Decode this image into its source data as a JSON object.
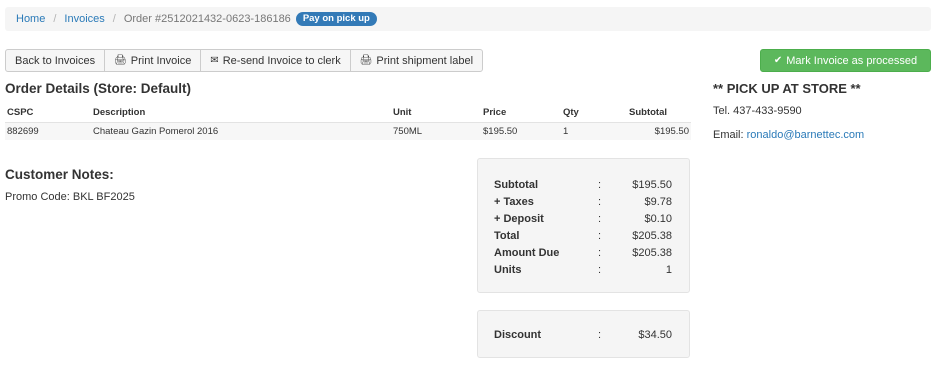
{
  "breadcrumb": {
    "home": "Home",
    "invoices": "Invoices",
    "current": "Order #2512021432-0623-186186",
    "badge": "Pay on pick up",
    "separator": "/"
  },
  "toolbar": {
    "back": "Back to Invoices",
    "print_invoice": "Print Invoice",
    "resend": "Re-send Invoice to clerk",
    "print_shipment": "Print shipment label",
    "mark_processed": "Mark Invoice as processed"
  },
  "icons": {
    "printer": "printer-icon",
    "envelope": "envelope-icon",
    "check": "check-icon"
  },
  "colors": {
    "link": "#2a7ab8",
    "badge": "#337ab7",
    "success": "#5cb85c"
  },
  "order": {
    "title": "Order Details (Store: Default)",
    "columns": [
      "CSPC",
      "Description",
      "Unit",
      "Price",
      "Qty",
      "Subtotal"
    ],
    "rows": [
      [
        "882699",
        "Chateau Gazin Pomerol 2016",
        "750ML",
        "$195.50",
        "1",
        "$195.50"
      ]
    ]
  },
  "notes": {
    "title": "Customer Notes:",
    "text": "Promo Code: BKL BF2025"
  },
  "totals": {
    "colon": ":",
    "rows": [
      {
        "label": "Subtotal",
        "value": "$195.50"
      },
      {
        "label": "+ Taxes",
        "value": "$9.78"
      },
      {
        "label": "+ Deposit",
        "value": "$0.10"
      },
      {
        "label": "Total",
        "value": "$205.38"
      },
      {
        "label": "Amount Due",
        "value": "$205.38"
      },
      {
        "label": "Units",
        "value": "1"
      }
    ],
    "discount": {
      "label": "Discount",
      "value": "$34.50"
    }
  },
  "pickup": {
    "title": "** PICK UP AT STORE **",
    "tel": "Tel. 437-433-9590",
    "email_label": "Email: ",
    "email": "ronaldo@barnettec.com"
  }
}
